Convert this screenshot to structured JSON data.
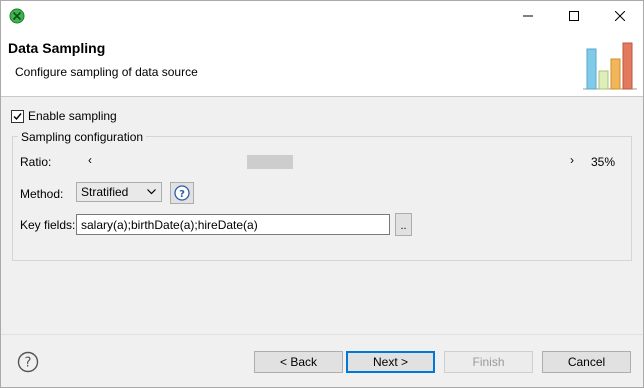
{
  "window": {
    "icons": {
      "app": "green-circle-x-icon",
      "minimize": "minimize-icon",
      "maximize": "maximize-icon",
      "close": "close-icon"
    }
  },
  "header": {
    "title": "Data Sampling",
    "subtitle": "Configure sampling of data source",
    "graphic_icon": "bar-chart-icon"
  },
  "enable_sampling": {
    "label": "Enable sampling",
    "checked": true
  },
  "group": {
    "title": "Sampling configuration",
    "ratio": {
      "label": "Ratio:",
      "left_arrow": "‹",
      "right_arrow": "›",
      "value_text": "35%",
      "value": 0.35
    },
    "method": {
      "label": "Method:",
      "selected": "Stratified",
      "help_icon": "question-icon"
    },
    "key_fields": {
      "label": "Key fields:",
      "value": "salary(a);birthDate(a);hireDate(a)",
      "browse_label": ".."
    }
  },
  "footer": {
    "help_icon": "question-circle-icon",
    "back": "< Back",
    "next": "Next >",
    "finish": "Finish",
    "cancel": "Cancel"
  }
}
